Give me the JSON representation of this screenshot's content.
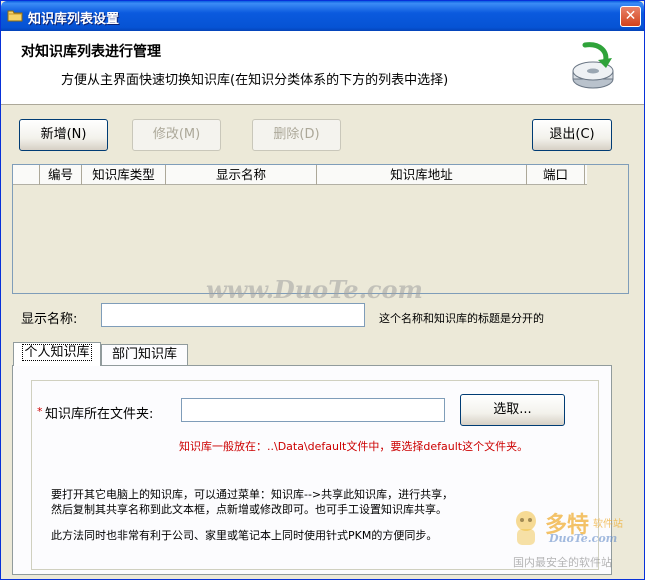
{
  "window": {
    "title": "知识库列表设置"
  },
  "header": {
    "title": "对知识库列表进行管理",
    "subtitle": "方便从主界面快速切换知识库(在知识分类体系的下方的列表中选择)"
  },
  "toolbar": {
    "add_label": "新增(N)",
    "edit_label": "修改(M)",
    "delete_label": "删除(D)",
    "exit_label": "退出(C)"
  },
  "table": {
    "columns": [
      "编号",
      "知识库类型",
      "显示名称",
      "知识库地址",
      "端口"
    ],
    "rows": []
  },
  "display_name": {
    "label": "显示名称:",
    "value": "",
    "hint": "这个名称和知识库的标题是分开的"
  },
  "tabs": [
    {
      "label": "个人知识库",
      "active": true
    },
    {
      "label": "部门知识库",
      "active": false
    }
  ],
  "personal": {
    "required_mark": "*",
    "folder_label": "知识库所在文件夹:",
    "folder_value": "",
    "browse_label": "选取...",
    "tip": "知识库一般放在：..\\Data\\default文件中，要选择default这个文件夹。",
    "help_line1": "要打开其它电脑上的知识库，可以通过菜单：知识库-->共享此知识库，进行共享，",
    "help_line2": "然后复制其共享名称到此文本框，点新增或修改即可。也可手工设置知识库共享。",
    "help_line3": "此方法同时也非常有利于公司、家里或笔记本上同时使用针式PKM的方便同步。"
  },
  "watermark": {
    "site": "www.DuoTe.com",
    "brand": "多特",
    "brand_suffix": "软件站",
    "brand_domain": "DuoTe.com",
    "slogan": "国内最安全的软件站"
  },
  "colors": {
    "titlebar": "#0653d4",
    "dialog_bg": "#ece9d8",
    "tip_red": "#cc0000"
  },
  "icons": {
    "title_icon": "folder-icon",
    "header_icon": "disk-sync-icon",
    "close_icon": "close-icon"
  }
}
